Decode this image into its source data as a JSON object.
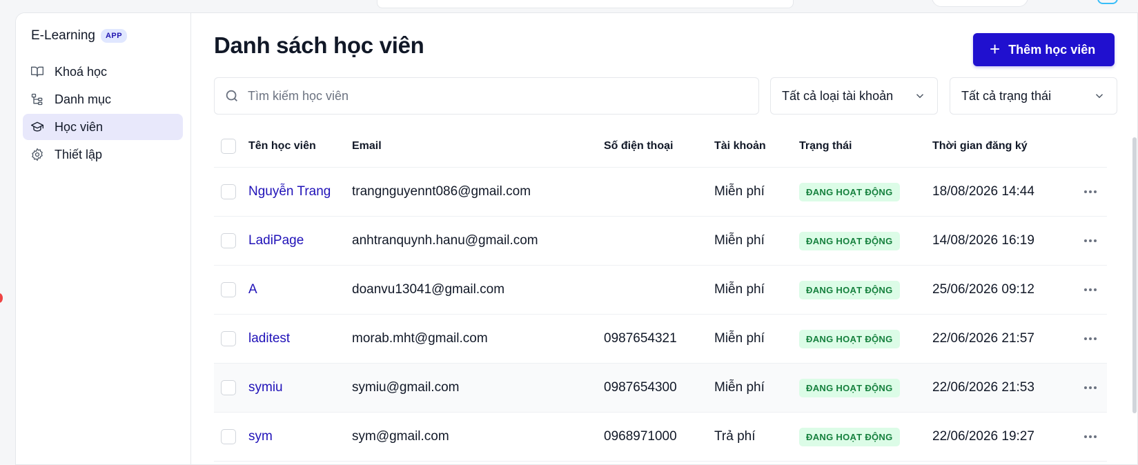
{
  "app": {
    "name": "E-Learning",
    "badge": "APP"
  },
  "sidebar": {
    "items": [
      {
        "label": "Khoá học",
        "icon": "book-open-icon"
      },
      {
        "label": "Danh mục",
        "icon": "tree-structure-icon"
      },
      {
        "label": "Học viên",
        "icon": "graduation-cap-icon",
        "active": true
      },
      {
        "label": "Thiết lập",
        "icon": "gear-icon"
      }
    ]
  },
  "page": {
    "title": "Danh sách học viên",
    "add_button": "Thêm học viên"
  },
  "filters": {
    "search_placeholder": "Tìm kiếm học viên",
    "account_type": "Tất cả loại tài khoản",
    "status": "Tất cả trạng thái"
  },
  "table": {
    "headers": {
      "name": "Tên học viên",
      "email": "Email",
      "phone": "Số điện thoại",
      "account": "Tài khoản",
      "status": "Trạng thái",
      "registered": "Thời gian đăng ký"
    },
    "rows": [
      {
        "name": "Nguyễn Trang",
        "email": "trangnguyennt086@gmail.com",
        "phone": "",
        "account": "Miễn phí",
        "status": "ĐANG HOẠT ĐỘNG",
        "registered": "18/08/2026 14:44"
      },
      {
        "name": "LadiPage",
        "email": "anhtranquynh.hanu@gmail.com",
        "phone": "",
        "account": "Miễn phí",
        "status": "ĐANG HOẠT ĐỘNG",
        "registered": "14/08/2026 16:19"
      },
      {
        "name": "A",
        "email": "doanvu13041@gmail.com",
        "phone": "",
        "account": "Miễn phí",
        "status": "ĐANG HOẠT ĐỘNG",
        "registered": "25/06/2026 09:12"
      },
      {
        "name": "laditest",
        "email": "morab.mht@gmail.com",
        "phone": "0987654321",
        "account": "Miễn phí",
        "status": "ĐANG HOẠT ĐỘNG",
        "registered": "22/06/2026 21:57"
      },
      {
        "name": "symiu",
        "email": "symiu@gmail.com",
        "phone": "0987654300",
        "account": "Miễn phí",
        "status": "ĐANG HOẠT ĐỘNG",
        "registered": "22/06/2026 21:53"
      },
      {
        "name": "sym",
        "email": "sym@gmail.com",
        "phone": "0968971000",
        "account": "Trả phí",
        "status": "ĐANG HOẠT ĐỘNG",
        "registered": "22/06/2026 19:27"
      }
    ]
  },
  "colors": {
    "primary": "#2010cf",
    "link": "#2012b8",
    "active_nav_bg": "#e8e8fb",
    "status_bg": "#dcfce7",
    "status_text": "#15803d"
  }
}
